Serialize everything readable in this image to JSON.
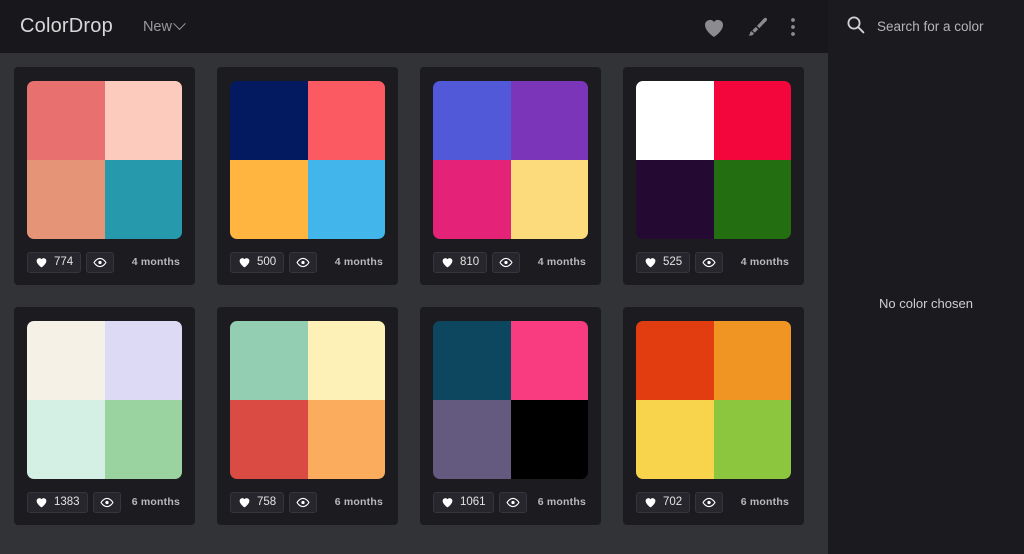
{
  "header": {
    "brand": "ColorDrop",
    "nav_new_label": "New",
    "icons": [
      {
        "name": "heart-icon",
        "title": "Favorites"
      },
      {
        "name": "paintbrush-icon",
        "title": "Palette"
      },
      {
        "name": "more-vertical-icon",
        "title": "More options"
      }
    ]
  },
  "search": {
    "icon": "search-icon",
    "placeholder": "Search for a color",
    "value": ""
  },
  "sidebar": {
    "empty_state": "No color chosen"
  },
  "theme": {
    "page_bg": "#313337",
    "panel_bg": "#1a1a1f",
    "topbar_bg": "#17171c",
    "card_bg": "#1b1b20",
    "pill_bg": "#26262c",
    "text": "#e6e6e6",
    "muted_text": "#9a9a9e"
  },
  "cards": [
    {
      "id": "palette-1",
      "likes": "774",
      "age": "4 months",
      "colors": [
        "#e8706e",
        "#fdcbbd",
        "#e69477",
        "#2799ad"
      ]
    },
    {
      "id": "palette-2",
      "likes": "500",
      "age": "4 months",
      "colors": [
        "#031a61",
        "#fb5a63",
        "#ffb53f",
        "#42b6ea"
      ]
    },
    {
      "id": "palette-3",
      "likes": "810",
      "age": "4 months",
      "colors": [
        "#5159d9",
        "#7b35b8",
        "#e32278",
        "#fcdb7d"
      ]
    },
    {
      "id": "palette-4",
      "likes": "525",
      "age": "4 months",
      "colors": [
        "#ffffff",
        "#f2063c",
        "#240a32",
        "#236e10"
      ]
    },
    {
      "id": "palette-5",
      "likes": "1383",
      "age": "6 months",
      "colors": [
        "#f6f1e6",
        "#dcdaf5",
        "#d4efe4",
        "#9bd3a0"
      ]
    },
    {
      "id": "palette-6",
      "likes": "758",
      "age": "6 months",
      "colors": [
        "#93ceb3",
        "#fdf1b8",
        "#da4b43",
        "#fcac5d"
      ]
    },
    {
      "id": "palette-7",
      "likes": "1061",
      "age": "6 months",
      "colors": [
        "#0c475f",
        "#f93c80",
        "#64597f",
        "#000000"
      ]
    },
    {
      "id": "palette-8",
      "likes": "702",
      "age": "6 months",
      "colors": [
        "#e23d11",
        "#f09423",
        "#f8d44c",
        "#8cc63f"
      ]
    }
  ]
}
